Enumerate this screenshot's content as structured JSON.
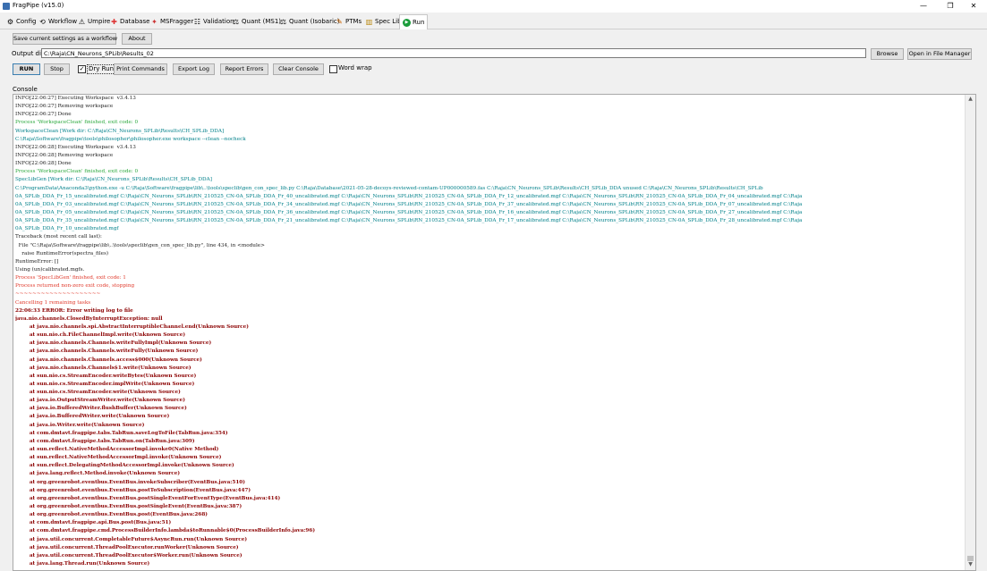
{
  "window": {
    "title": "FragPipe (v15.0)",
    "controls": {
      "minimize": "—",
      "maximize": "❐",
      "close": "✕"
    }
  },
  "tabs": [
    {
      "label": "Config",
      "icon": "gear-icon",
      "glyph": "⚙"
    },
    {
      "label": "Workflow",
      "icon": "workflow-icon",
      "glyph": "⟲"
    },
    {
      "label": "Umpire",
      "icon": "umpire-icon",
      "glyph": "⚠"
    },
    {
      "label": "Database",
      "icon": "database-icon",
      "glyph": "✚"
    },
    {
      "label": "MSFragger",
      "icon": "msfragger-icon",
      "glyph": "✦"
    },
    {
      "label": "Validation",
      "icon": "validation-icon",
      "glyph": "☷"
    },
    {
      "label": "Quant (MS1)",
      "icon": "scale-icon",
      "glyph": "⚖"
    },
    {
      "label": "Quant (Isobaric)",
      "icon": "scale-icon",
      "glyph": "⚖"
    },
    {
      "label": "PTMs",
      "icon": "pen-icon",
      "glyph": "✎"
    },
    {
      "label": "Spec Lib",
      "icon": "library-icon",
      "glyph": "▥"
    },
    {
      "label": "Run",
      "icon": "play-icon",
      "glyph": "▶"
    }
  ],
  "top_buttons": {
    "save_workflow": "Save current settings as a workflow",
    "about": "About"
  },
  "output": {
    "label": "Output dir:",
    "value": "C:\\Raja\\CN_Neurons_SPLib\\Results_02",
    "browse": "Browse",
    "open_fm": "Open in File Manager"
  },
  "actions": {
    "run": "RUN",
    "stop": "Stop",
    "dry_run": "Dry Run",
    "dry_run_checked": true,
    "print_commands": "Print Commands",
    "export_log": "Export Log",
    "report_errors": "Report Errors",
    "clear_console": "Clear Console",
    "word_wrap": "Word wrap",
    "word_wrap_checked": false
  },
  "console": {
    "label": "Console",
    "lines": [
      {
        "text": "INFO[22:06:27] Executing Workspace  v3.4.13",
        "color": "black"
      },
      {
        "text": "INFO[22:06:27] Removing workspace",
        "color": "black"
      },
      {
        "text": "INFO[22:06:27] Done",
        "color": "black"
      },
      {
        "text": "Process 'WorkspaceClean' finished, exit code: 0",
        "color": "green"
      },
      {
        "text": "WorkspaceClean [Work dir: C:\\Raja\\CN_Neurons_SPLib\\Results\\CH_SPLib_DDA]",
        "color": "teal"
      },
      {
        "text": "C:\\Raja\\Software\\fragpipe\\tools\\philosopher\\philosopher.exe workspace --clean --nocheck",
        "color": "teal"
      },
      {
        "text": "INFO[22:06:28] Executing Workspace  v3.4.13",
        "color": "black"
      },
      {
        "text": "INFO[22:06:28] Removing workspace",
        "color": "black"
      },
      {
        "text": "INFO[22:06:28] Done",
        "color": "black"
      },
      {
        "text": "Process 'WorkspaceClean' finished, exit code: 0",
        "color": "green"
      },
      {
        "text": "SpecLibGen [Work dir: C:\\Raja\\CN_Neurons_SPLib\\Results\\CH_SPLib_DDA]",
        "color": "teal"
      },
      {
        "text": "C:\\ProgramData\\Anaconda3\\python.exe -u C:\\Raja\\Software\\fragpipe\\lib\\..\\tools\\speclib\\gen_con_spec_lib.py C:\\Raja\\Database\\2021-05-28-decoys-reviewed-contam-UP000000589.fas C:\\Raja\\CN_Neurons_SPLib\\Results\\CH_SPLib_DDA unused C:\\Raja\\CN_Neurons_SPLib\\Results\\CH_SPLib",
        "color": "teal"
      },
      {
        "text": "0A_SPLib_DDA_Fr_15_uncalibrated.mgf C:\\Raja\\CN_Neurons_SPLib\\RN_210525_CN-0A_SPLib_DDA_Fr_40_uncalibrated.mgf C:\\Raja\\CN_Neurons_SPLib\\RN_210525_CN-0A_SPLib_DDA_Fr_12_uncalibrated.mgf C:\\Raja\\CN_Neurons_SPLib\\RN_210525_CN-0A_SPLib_DDA_Fr_04_uncalibrated.mgf C:\\Raja",
        "color": "teal"
      },
      {
        "text": "0A_SPLib_DDA_Fr_03_uncalibrated.mgf C:\\Raja\\CN_Neurons_SPLib\\RN_210525_CN-0A_SPLib_DDA_Fr_34_uncalibrated.mgf C:\\Raja\\CN_Neurons_SPLib\\RN_210525_CN-0A_SPLib_DDA_Fr_37_uncalibrated.mgf C:\\Raja\\CN_Neurons_SPLib\\RN_210525_CN-0A_SPLib_DDA_Fr_07_uncalibrated.mgf C:\\Raja",
        "color": "teal"
      },
      {
        "text": "0A_SPLib_DDA_Fr_05_uncalibrated.mgf C:\\Raja\\CN_Neurons_SPLib\\RN_210525_CN-0A_SPLib_DDA_Fr_36_uncalibrated.mgf C:\\Raja\\CN_Neurons_SPLib\\RN_210525_CN-0A_SPLib_DDA_Fr_16_uncalibrated.mgf C:\\Raja\\CN_Neurons_SPLib\\RN_210525_CN-0A_SPLib_DDA_Fr_27_uncalibrated.mgf C:\\Raja",
        "color": "teal"
      },
      {
        "text": "0A_SPLib_DDA_Fr_35_uncalibrated.mgf C:\\Raja\\CN_Neurons_SPLib\\RN_210525_CN-0A_SPLib_DDA_Fr_21_uncalibrated.mgf C:\\Raja\\CN_Neurons_SPLib\\RN_210525_CN-0A_SPLib_DDA_Fr_17_uncalibrated.mgf C:\\Raja\\CN_Neurons_SPLib\\RN_210525_CN-0A_SPLib_DDA_Fr_28_uncalibrated.mgf C:\\Raja",
        "color": "teal"
      },
      {
        "text": "0A_SPLib_DDA_Fr_10_uncalibrated.mgf",
        "color": "teal"
      },
      {
        "text": "Traceback (most recent call last):",
        "color": "black"
      },
      {
        "text": "  File \"C:\\Raja\\Software\\fragpipe\\lib\\..\\tools\\speclib\\gen_con_spec_lib.py\", line 434, in <module>",
        "color": "black"
      },
      {
        "text": "    raise RuntimeError(spectra_files)",
        "color": "black"
      },
      {
        "text": "RuntimeError: []",
        "color": "black"
      },
      {
        "text": "Using (un)calibrated.mgfs.",
        "color": "black"
      },
      {
        "text": "Process 'SpecLibGen' finished, exit code: 1",
        "color": "red"
      },
      {
        "text": "Process returned non-zero exit code, stopping",
        "color": "red"
      },
      {
        "text": "~~~~~~~~~~~~~~~~~~~~",
        "color": "red"
      },
      {
        "text": "Cancelling 1 remaining tasks",
        "color": "red"
      },
      {
        "text": "22:06:33 ERROR: Error writing log to file",
        "color": "dred"
      },
      {
        "text": "java.nio.channels.ClosedByInterruptException: null",
        "color": "dred"
      },
      {
        "text": "        at java.nio.channels.spi.AbstractInterruptibleChannel.end(Unknown Source)",
        "color": "dred"
      },
      {
        "text": "        at sun.nio.ch.FileChannelImpl.write(Unknown Source)",
        "color": "dred"
      },
      {
        "text": "        at java.nio.channels.Channels.writeFullyImpl(Unknown Source)",
        "color": "dred"
      },
      {
        "text": "        at java.nio.channels.Channels.writeFully(Unknown Source)",
        "color": "dred"
      },
      {
        "text": "        at java.nio.channels.Channels.access$000(Unknown Source)",
        "color": "dred"
      },
      {
        "text": "        at java.nio.channels.Channels$1.write(Unknown Source)",
        "color": "dred"
      },
      {
        "text": "        at sun.nio.cs.StreamEncoder.writeBytes(Unknown Source)",
        "color": "dred"
      },
      {
        "text": "        at sun.nio.cs.StreamEncoder.implWrite(Unknown Source)",
        "color": "dred"
      },
      {
        "text": "        at sun.nio.cs.StreamEncoder.write(Unknown Source)",
        "color": "dred"
      },
      {
        "text": "        at java.io.OutputStreamWriter.write(Unknown Source)",
        "color": "dred"
      },
      {
        "text": "        at java.io.BufferedWriter.flushBuffer(Unknown Source)",
        "color": "dred"
      },
      {
        "text": "        at java.io.BufferedWriter.write(Unknown Source)",
        "color": "dred"
      },
      {
        "text": "        at java.io.Writer.write(Unknown Source)",
        "color": "dred"
      },
      {
        "text": "        at com.dmtavt.fragpipe.tabs.TabRun.saveLogToFile(TabRun.java:354)",
        "color": "dred"
      },
      {
        "text": "        at com.dmtavt.fragpipe.tabs.TabRun.on(TabRun.java:309)",
        "color": "dred"
      },
      {
        "text": "        at sun.reflect.NativeMethodAccessorImpl.invoke0(Native Method)",
        "color": "dred"
      },
      {
        "text": "        at sun.reflect.NativeMethodAccessorImpl.invoke(Unknown Source)",
        "color": "dred"
      },
      {
        "text": "        at sun.reflect.DelegatingMethodAccessorImpl.invoke(Unknown Source)",
        "color": "dred"
      },
      {
        "text": "        at java.lang.reflect.Method.invoke(Unknown Source)",
        "color": "dred"
      },
      {
        "text": "        at org.greenrobot.eventbus.EventBus.invokeSubscriber(EventBus.java:510)",
        "color": "dred"
      },
      {
        "text": "        at org.greenrobot.eventbus.EventBus.postToSubscription(EventBus.java:447)",
        "color": "dred"
      },
      {
        "text": "        at org.greenrobot.eventbus.EventBus.postSingleEventForEventType(EventBus.java:414)",
        "color": "dred"
      },
      {
        "text": "        at org.greenrobot.eventbus.EventBus.postSingleEvent(EventBus.java:387)",
        "color": "dred"
      },
      {
        "text": "        at org.greenrobot.eventbus.EventBus.post(EventBus.java:268)",
        "color": "dred"
      },
      {
        "text": "        at com.dmtavt.fragpipe.api.Bus.post(Bus.java:51)",
        "color": "dred"
      },
      {
        "text": "        at com.dmtavt.fragpipe.cmd.ProcessBuilderInfo.lambda$toRunnable$0(ProcessBuilderInfo.java:96)",
        "color": "dred"
      },
      {
        "text": "        at java.util.concurrent.CompletableFuture$AsyncRun.run(Unknown Source)",
        "color": "dred"
      },
      {
        "text": "        at java.util.concurrent.ThreadPoolExecutor.runWorker(Unknown Source)",
        "color": "dred"
      },
      {
        "text": "        at java.util.concurrent.ThreadPoolExecutor$Worker.run(Unknown Source)",
        "color": "dred"
      },
      {
        "text": "        at java.lang.Thread.run(Unknown Source)",
        "color": "dred"
      }
    ]
  },
  "scrollbar": {
    "up_glyph": "▲",
    "down_glyph": "▼"
  }
}
